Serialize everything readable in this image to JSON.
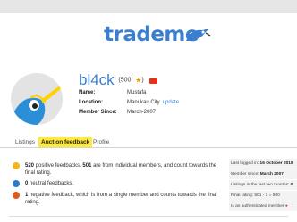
{
  "brand": {
    "logo_text": "trademe"
  },
  "profile": {
    "username": "bl4ck",
    "score": "(500",
    "score_close": ")",
    "fields": [
      {
        "label": "Name:",
        "value": "Mustafa"
      },
      {
        "label": "Location:",
        "value": "Manukau City",
        "link": "update"
      },
      {
        "label": "Member Since:",
        "value": "March-2007"
      }
    ]
  },
  "tabs": [
    "Listings",
    "Auction feedback",
    "Profile"
  ],
  "feedback": {
    "positive": {
      "count": "520",
      "text_a": " positive feedbacks. ",
      "count2": "501",
      "text_b": " are from individual members, and count towards the final rating."
    },
    "neutral": {
      "count": "0",
      "text": " neutral feedbacks."
    },
    "negative": {
      "count": "1",
      "text": " negative feedback, which is from a single member and counts towards the final rating."
    }
  },
  "sidebar": {
    "last_login_label": "Last logged in: ",
    "last_login": "16 October 2018",
    "member_since_label": "Member since: ",
    "member_since": "March 2007",
    "listings_label": "Listings in the last two months: ",
    "listings": "0",
    "final_rating": "Final rating: 501 - 1 = 500",
    "authenticated": "Is an authenticated member"
  },
  "colors": {
    "accent": "#3a7fcf",
    "tab_active": "#ffe93b",
    "positive": "#f1b71c",
    "neutral": "#2e78c9",
    "negative": "#e05a1c",
    "badge": "#e2331a"
  },
  "icons": [
    "trademe-kiwi-logo",
    "kiwi-avatar",
    "star-icon",
    "badge-icon",
    "positive-face-icon",
    "neutral-face-icon",
    "negative-face-icon",
    "authenticated-flag-icon"
  ]
}
